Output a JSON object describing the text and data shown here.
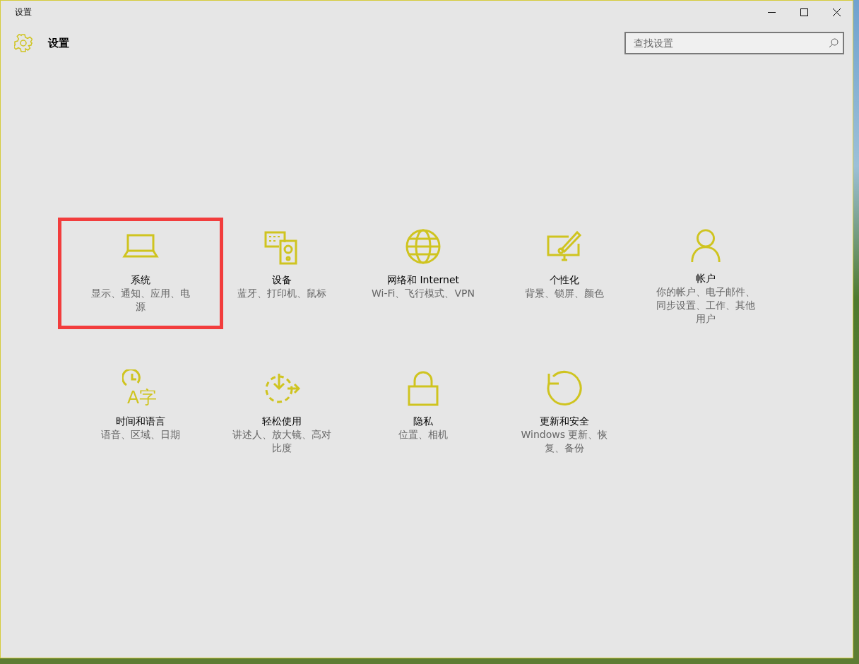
{
  "window": {
    "title": "设置"
  },
  "header": {
    "title": "设置"
  },
  "search": {
    "placeholder": "查找设置"
  },
  "tiles": [
    {
      "kind": "laptop",
      "label": "系统",
      "description": "显示、通知、应用、电源",
      "highlighted": true
    },
    {
      "kind": "devices",
      "label": "设备",
      "description": "蓝牙、打印机、鼠标",
      "highlighted": false
    },
    {
      "kind": "globe",
      "label": "网络和 Internet",
      "description": "Wi-Fi、飞行模式、VPN",
      "highlighted": false
    },
    {
      "kind": "paint",
      "label": "个性化",
      "description": "背景、锁屏、颜色",
      "highlighted": false
    },
    {
      "kind": "person",
      "label": "帐户",
      "description": "你的帐户、电子邮件、同步设置、工作、其他用户",
      "highlighted": false
    },
    {
      "kind": "time_language",
      "label": "时间和语言",
      "description": "语音、区域、日期",
      "highlighted": false,
      "icon_glyph": "A字"
    },
    {
      "kind": "ease",
      "label": "轻松使用",
      "description": "讲述人、放大镜、高对比度",
      "highlighted": false
    },
    {
      "kind": "lock",
      "label": "隐私",
      "description": "位置、相机",
      "highlighted": false
    },
    {
      "kind": "update",
      "label": "更新和安全",
      "description": "Windows 更新、恢复、备份",
      "highlighted": false
    }
  ]
}
